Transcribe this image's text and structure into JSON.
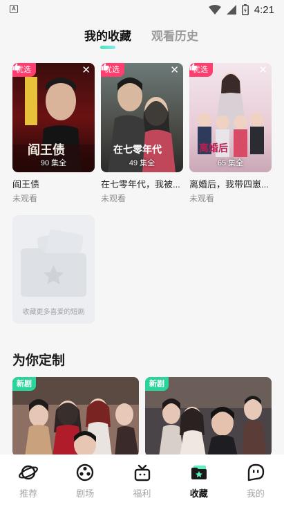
{
  "status_bar": {
    "time": "4:21",
    "app_icon": "A"
  },
  "tabs": [
    {
      "label": "我的收藏",
      "active": true
    },
    {
      "label": "观看历史",
      "active": false
    }
  ],
  "favorites": [
    {
      "badge": "优选",
      "episodes": "90 集全",
      "title": "阎王债",
      "status": "未观看",
      "poster_text": "阎王债"
    },
    {
      "badge": "优选",
      "episodes": "49 集全",
      "title": "在七零年代，我被...",
      "status": "未观看",
      "poster_text": "在七零年代"
    },
    {
      "badge": "优选",
      "episodes": "65 集全",
      "title": "离婚后，我带四崽...",
      "status": "未观看",
      "poster_text": "离婚后"
    }
  ],
  "add_card": {
    "caption": "收藏更多喜爱的短剧"
  },
  "recommend": {
    "title": "为你定制",
    "items": [
      {
        "badge": "新剧"
      },
      {
        "badge": "新剧"
      }
    ]
  },
  "bottom_nav": [
    {
      "label": "推荐",
      "icon": "planet-icon",
      "active": false
    },
    {
      "label": "剧场",
      "icon": "film-reel-icon",
      "active": false
    },
    {
      "label": "福利",
      "icon": "gift-box-icon",
      "active": false
    },
    {
      "label": "收藏",
      "icon": "folder-star-icon",
      "active": true
    },
    {
      "label": "我的",
      "icon": "chat-face-icon",
      "active": false
    }
  ],
  "colors": {
    "accent_pick": "#ff3d6e",
    "accent_new": "#2ad59b",
    "tab_indicator": "#4de2b7",
    "background": "#f6f6f7"
  }
}
